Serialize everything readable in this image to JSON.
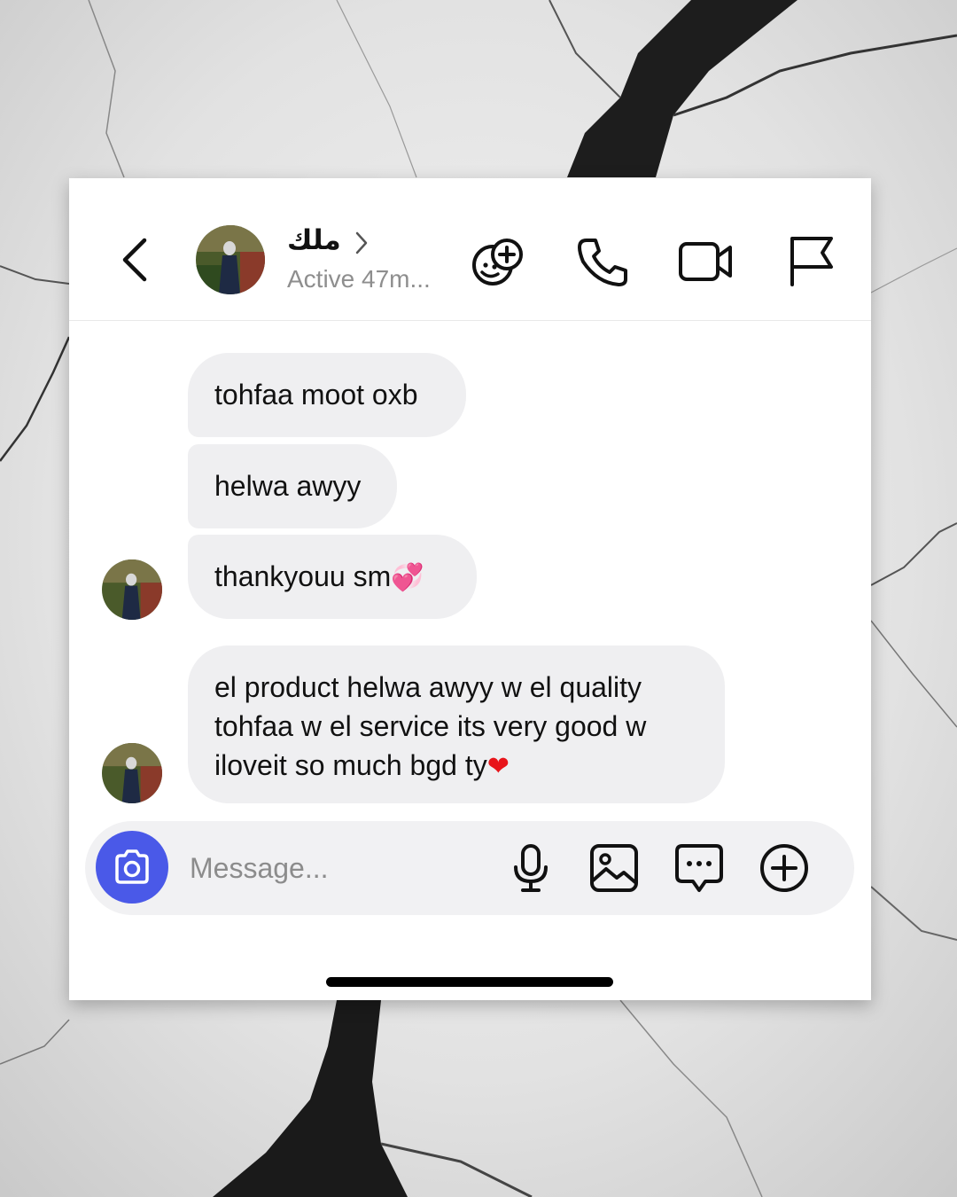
{
  "header": {
    "contact_name": "ملك",
    "status": "Active 47m..."
  },
  "messages": [
    {
      "text": "tohfaa moot oxb",
      "emoji": ""
    },
    {
      "text": "helwa awyy",
      "emoji": ""
    },
    {
      "text": "thankyouu sm",
      "emoji": "💞"
    },
    {
      "text": "el product helwa awyy w el quality tohfaa w el service its very good w iloveit so much bgd ty",
      "emoji": "❤"
    }
  ],
  "composer": {
    "placeholder": "Message..."
  },
  "colors": {
    "accent": "#4a59e8",
    "bubble": "#efeff1",
    "heart": "#e8151b"
  },
  "icons": [
    "back-icon",
    "chevron-right-icon",
    "sticker-add-icon",
    "phone-icon",
    "video-camera-icon",
    "flag-icon",
    "camera-icon",
    "microphone-icon",
    "gallery-icon",
    "chat-bubble-icon",
    "plus-circle-icon"
  ]
}
